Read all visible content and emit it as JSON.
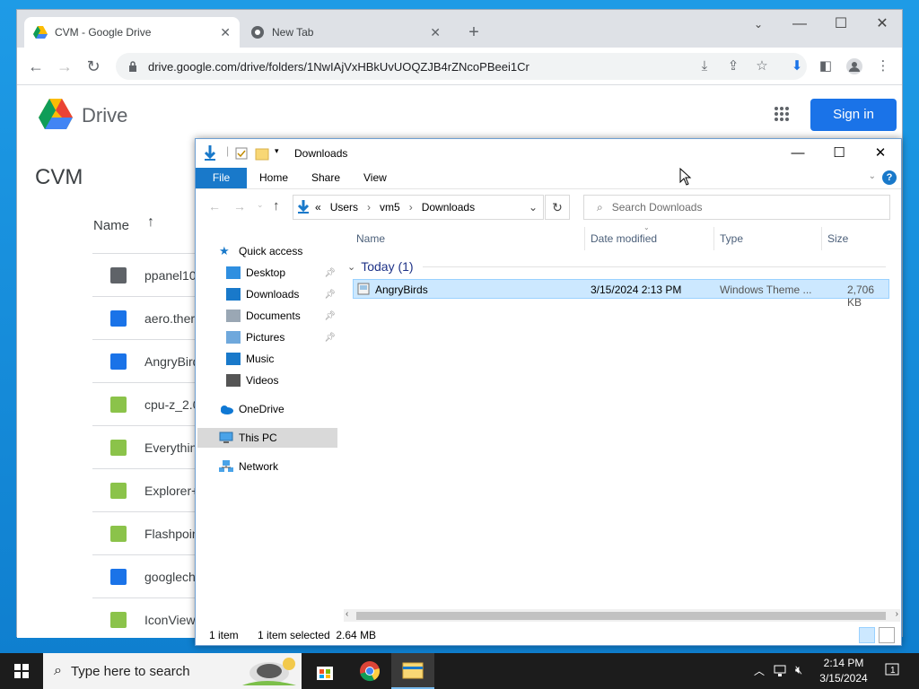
{
  "browser": {
    "tabs": [
      {
        "title": "CVM - Google Drive",
        "active": true
      },
      {
        "title": "New Tab",
        "active": false
      }
    ],
    "url": "drive.google.com/drive/folders/1NwIAjVxHBkUvUOQZJB4rZNcoPBeei1Cr"
  },
  "drive": {
    "logo_text": "Drive",
    "signin_label": "Sign in",
    "folder_title": "CVM",
    "name_header": "Name",
    "sort_indicator": "↑",
    "files": [
      {
        "name": "ppanel10",
        "icon": "shared-folder-icon",
        "color": "#5f6368"
      },
      {
        "name": "aero.ther",
        "icon": "doc-icon",
        "color": "#1a73e8"
      },
      {
        "name": "AngryBird",
        "icon": "doc-icon",
        "color": "#1a73e8"
      },
      {
        "name": "cpu-z_2.0",
        "icon": "archive-icon",
        "color": "#8bc34a"
      },
      {
        "name": "Everythin",
        "icon": "archive-icon",
        "color": "#8bc34a"
      },
      {
        "name": "Explorer+",
        "icon": "archive-icon",
        "color": "#8bc34a"
      },
      {
        "name": "Flashpoin",
        "icon": "archive-icon",
        "color": "#8bc34a"
      },
      {
        "name": "googlech",
        "icon": "image-icon",
        "color": "#1a73e8"
      },
      {
        "name": "IconView",
        "icon": "archive-icon",
        "color": "#8bc34a"
      }
    ]
  },
  "explorer": {
    "title": "Downloads",
    "ribbon_tabs": [
      "File",
      "Home",
      "Share",
      "View"
    ],
    "address": {
      "prefix": "«",
      "crumbs": [
        "Users",
        "vm5",
        "Downloads"
      ]
    },
    "search_placeholder": "Search Downloads",
    "nav": {
      "quick_access": "Quick access",
      "items": [
        {
          "label": "Desktop",
          "pinned": true
        },
        {
          "label": "Downloads",
          "pinned": true
        },
        {
          "label": "Documents",
          "pinned": true
        },
        {
          "label": "Pictures",
          "pinned": true
        },
        {
          "label": "Music",
          "pinned": false
        },
        {
          "label": "Videos",
          "pinned": false
        }
      ],
      "onedrive": "OneDrive",
      "this_pc": "This PC",
      "network": "Network"
    },
    "columns": [
      "Name",
      "Date modified",
      "Type",
      "Size"
    ],
    "group_label": "Today (1)",
    "file": {
      "name": "AngryBirds",
      "date": "3/15/2024 2:13 PM",
      "type": "Windows Theme ...",
      "size": "2,706 KB"
    },
    "status": {
      "count": "1 item",
      "selected": "1 item selected  2.64 MB"
    }
  },
  "taskbar": {
    "search_placeholder": "Type here to search",
    "time": "2:14 PM",
    "date": "3/15/2024",
    "notification_count": "1"
  }
}
